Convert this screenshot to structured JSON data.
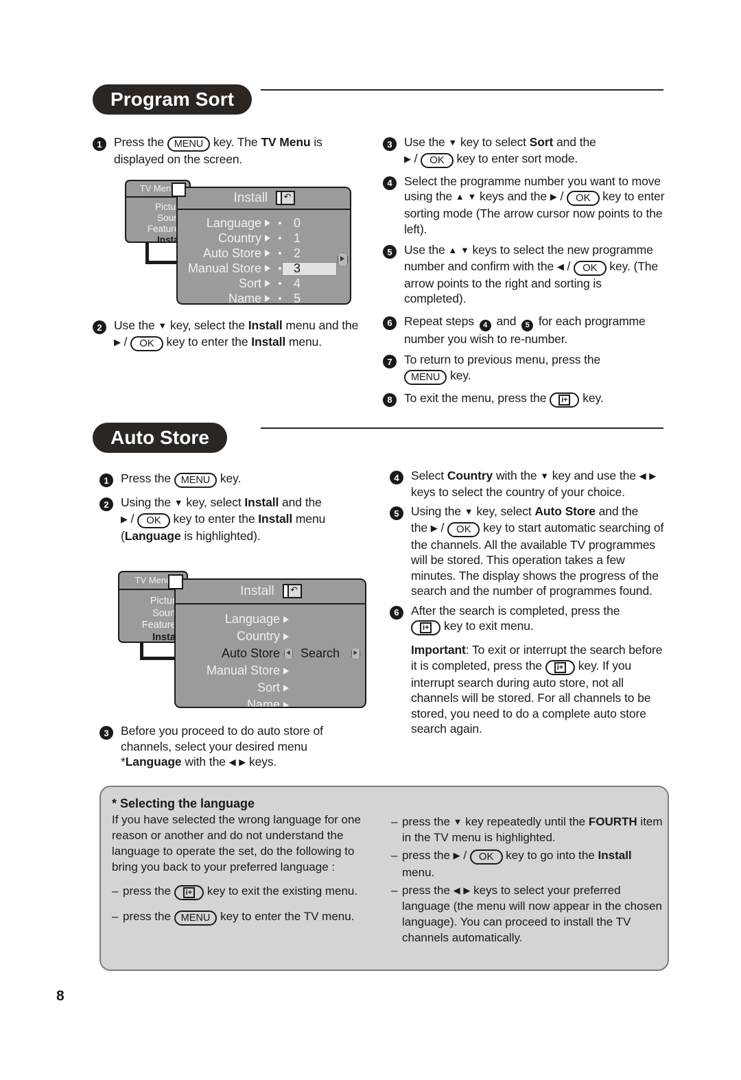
{
  "page": {
    "number": "8"
  },
  "sections": [
    {
      "title": "Program Sort",
      "left_steps": [
        {
          "n": "1",
          "html_id": "ps1"
        },
        {
          "n": "2",
          "html_id": "ps2"
        }
      ],
      "right_steps": [
        {
          "n": "3"
        },
        {
          "n": "4"
        },
        {
          "n": "5"
        },
        {
          "n": "6"
        },
        {
          "n": "7"
        },
        {
          "n": "8"
        }
      ]
    },
    {
      "title": "Auto Store"
    }
  ],
  "program_sort": {
    "title": "Program Sort",
    "step1": {
      "num": "1",
      "a": "Press the",
      "key": "MENU",
      "b": "key. The",
      "bold": "TV Menu",
      "c": "is displayed on the screen."
    },
    "step2": {
      "num": "2",
      "a": "Use the",
      "arrow_down": "▼",
      "b": "key, select the",
      "bold1": "Install",
      "c": "menu and the",
      "arrow_right": "▶",
      "slash": "/",
      "key": "OK",
      "d": "key to enter the",
      "bold2": "Install",
      "e": "menu."
    },
    "step3": {
      "num": "3",
      "a": "Use the",
      "arrow_down": "▼",
      "b": "key to select",
      "bold": "Sort",
      "c": "and the",
      "arrow_right": "▶",
      "slash": "/",
      "key": "OK",
      "d": "key to enter sort mode."
    },
    "step4": {
      "num": "4",
      "a": "Select the programme number you want to move using the",
      "arrow_up": "▲",
      "arrow_down": "▼",
      "b": "keys and the",
      "arrow_right": "▶",
      "slash": "/",
      "key": "OK",
      "c": "key to enter sorting mode (The arrow cursor now points to the left)."
    },
    "step5": {
      "num": "5",
      "a": "Use the",
      "arrow_up": "▲",
      "arrow_down": "▼",
      "b": "keys to select the new programme number and confirm with the",
      "arrow_left": "◀",
      "slash": "/",
      "key": "OK",
      "c": "key. (The arrow points to the right and  sorting is completed)."
    },
    "step6": {
      "num": "6",
      "a": "Repeat steps",
      "ref1": "4",
      "b": "and",
      "ref2": "5",
      "c": "for each programme number you wish to re-number."
    },
    "step7": {
      "num": "7",
      "a": "To return to previous menu, press the",
      "key": "MENU",
      "b": "key."
    },
    "step8": {
      "num": "8",
      "a": "To exit the menu, press the",
      "key": "i+",
      "b": "key."
    }
  },
  "auto_store": {
    "title": "Auto Store",
    "step1": {
      "num": "1",
      "a": "Press the",
      "key": "MENU",
      "b": "key."
    },
    "step2": {
      "num": "2",
      "a": "Using the",
      "arrow_down": "▼",
      "b": "key, select",
      "bold1": "Install",
      "c": "and the",
      "arrow_right": "▶",
      "slash": "/",
      "key": "OK",
      "d": "key to enter the",
      "bold2": "Install",
      "e": "menu (",
      "bold3": "Language",
      "f": "is highlighted)."
    },
    "step3": {
      "num": "3",
      "a": "Before you proceed to do auto store of channels, select your desired menu *",
      "bold": "Language",
      "b": "with the",
      "arrow_left": "◀",
      "arrow_right": "▶",
      "c": "keys."
    },
    "step4": {
      "num": "4",
      "a": "Select",
      "bold": "Country",
      "b": "with the",
      "arrow_down": "▼",
      "c": "key and use the",
      "arrow_left": "◀",
      "arrow_right": "▶",
      "d": "keys to select the country of your choice."
    },
    "step5": {
      "num": "5",
      "a": "Using the",
      "arrow_down": "▼",
      "b": "key, select",
      "bold": "Auto Store",
      "c": "and the",
      "arrow_right": "▶",
      "slash": "/",
      "key": "OK",
      "d": "key to start automatic searching of the channels. All the available TV programmes will be stored. This operation takes a few minutes. The display shows the progress of the search and the number of programmes found."
    },
    "step6": {
      "num": "6",
      "a": "After the search is completed, press the",
      "key": "i+",
      "b": "key to exit menu."
    },
    "important": {
      "label": "Important",
      "a": ": To exit or interrupt the search before it is completed, press the",
      "key": "i+",
      "b": "key. If you interrupt search during auto store, not all channels will be stored. For all channels to be stored, you need to do a complete auto store search again."
    }
  },
  "tv_menu_1": {
    "left_title": "TV Menu",
    "left_items": [
      "Picture",
      "Sound",
      "Features",
      "Install"
    ],
    "left_selected": "Install",
    "right_title": "Install",
    "rows": [
      {
        "label": "Language",
        "num": "0",
        "highlighted": false
      },
      {
        "label": "Country",
        "num": "1",
        "highlighted": false
      },
      {
        "label": "Auto Store",
        "num": "2",
        "highlighted": false
      },
      {
        "label": "Manual Store",
        "num": "3",
        "highlighted": true
      },
      {
        "label": "Sort",
        "num": "4",
        "highlighted": false
      },
      {
        "label": "Name",
        "num": "5",
        "highlighted": false
      }
    ]
  },
  "tv_menu_2": {
    "left_title": "TV Menu",
    "left_items": [
      "Picture",
      "Sound",
      "Features",
      "Install"
    ],
    "left_selected": "Install",
    "right_title": "Install",
    "rows": [
      {
        "label": "Language",
        "value": "",
        "type": "arrow"
      },
      {
        "label": "Country",
        "value": "",
        "type": "arrow"
      },
      {
        "label": "Auto Store",
        "value": "Search",
        "type": "search"
      },
      {
        "label": "Manual Store",
        "value": "",
        "type": "arrow"
      },
      {
        "label": "Sort",
        "value": "",
        "type": "arrow"
      },
      {
        "label": "Name",
        "value": "",
        "type": "arrow"
      }
    ]
  },
  "note_box": {
    "title": "* Selecting the language",
    "paragraph": "If you have selected the wrong language for one reason or another and do not understand the language to operate the set, do the following to bring you back to your preferred language :",
    "left_items": [
      {
        "a": "press the",
        "key": "i+",
        "b": "key to exit the existing menu."
      },
      {
        "a": "press the",
        "key": "MENU",
        "b": "key to enter the TV menu."
      }
    ],
    "right_items": [
      {
        "a": "press the",
        "arrow_down": "▼",
        "b": "key repeatedly until the",
        "bold": "FOURTH",
        "c": "item in the TV menu is highlighted."
      },
      {
        "a": "press the",
        "arrow_right": "▶",
        "slash": "/",
        "key": "OK",
        "b": "key to go into the",
        "bold": "Install",
        "c": "menu."
      },
      {
        "a": "press the",
        "arrow_left": "◀",
        "arrow_right": "▶",
        "b": "keys to select your preferred language (the menu will now appear in the chosen language). You can proceed to install the  TV channels automatically."
      }
    ]
  },
  "colors": {
    "pill_bg": "#2b2622",
    "menu_gray": "#9b9b9b",
    "highlight_gray": "#e2e2e2",
    "note_bg": "#d4d4d4",
    "ink": "#1a1a1a"
  }
}
